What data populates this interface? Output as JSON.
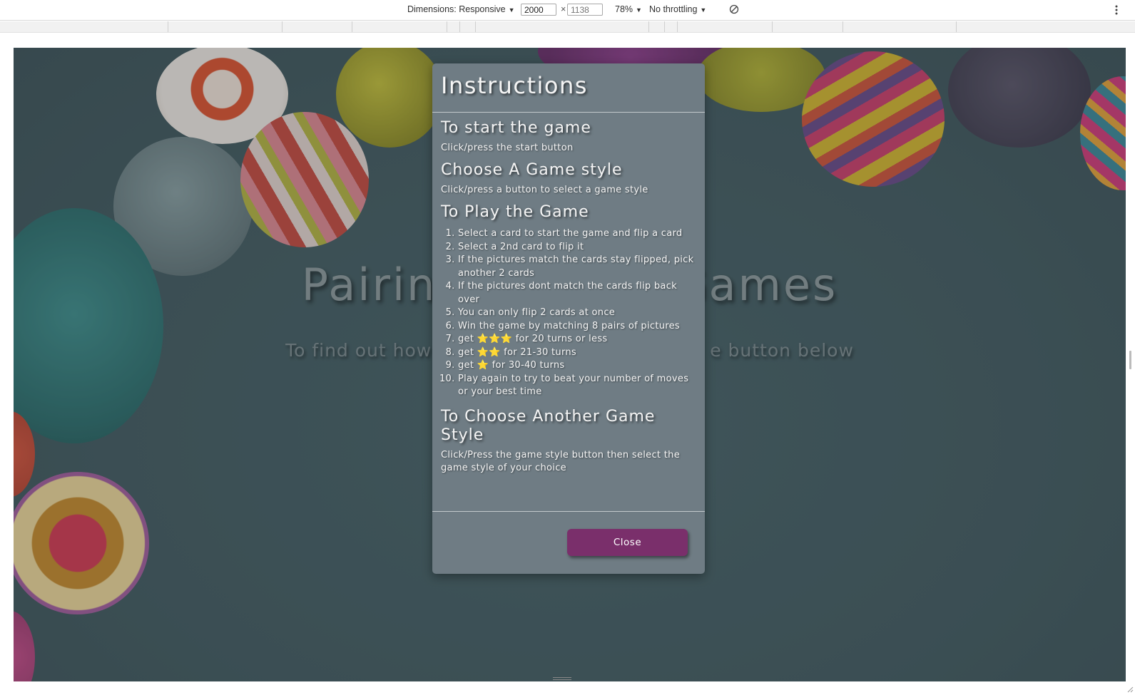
{
  "devtools": {
    "dimensions_label": "Dimensions: Responsive",
    "width_value": "2000",
    "height_value": "1138",
    "times": "×",
    "zoom": "78%",
    "throttling": "No throttling"
  },
  "page": {
    "title_left": "Pairin",
    "title_right": "Games",
    "subtitle_left": "To find out how",
    "subtitle_right": "e button below"
  },
  "modal": {
    "title": "Instructions",
    "start_heading": "To start the game",
    "start_text": "Click/press the start button",
    "style_heading": "Choose A Game style",
    "style_text": "Click/press a button to select a game style",
    "play_heading": "To Play the Game",
    "steps": [
      "Select a card to start the game and flip a card",
      "Select a 2nd card to flip it",
      "If the pictures match the cards stay flipped, pick another 2 cards",
      "If the pictures dont match the cards flip back over",
      "You can only flip 2 cards at once",
      "Win the game by matching 8 pairs of pictures",
      "get",
      "get",
      "get",
      "Play again to try to beat your number of moves or your best time"
    ],
    "star_steps": {
      "three": {
        "stars": "⭐⭐⭐",
        "text": "for 20 turns or less"
      },
      "two": {
        "stars": "⭐⭐",
        "text": "for 21-30 turns"
      },
      "one": {
        "stars": "⭐",
        "text": "for 30-40 turns"
      }
    },
    "another_heading": "To Choose Another Game Style",
    "another_text": "Click/Press the game style button then select the game style of your choice",
    "close_label": "Close"
  },
  "colors": {
    "modal_bg": "#6f7c84",
    "close_button": "#7a2f6b",
    "page_bg": "#455d63"
  }
}
